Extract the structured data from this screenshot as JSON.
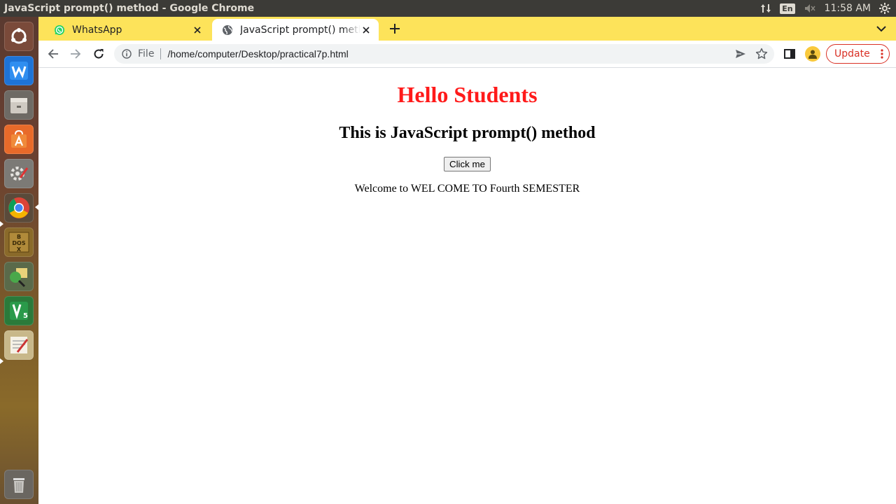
{
  "window": {
    "title": "JavaScript prompt() method - Google Chrome"
  },
  "system": {
    "language": "En",
    "time": "11:58 AM"
  },
  "launcher": {
    "items": [
      {
        "name": "dash-home-icon"
      },
      {
        "name": "wps-writer-icon"
      },
      {
        "name": "files-icon"
      },
      {
        "name": "software-center-icon"
      },
      {
        "name": "system-settings-icon"
      },
      {
        "name": "chrome-icon"
      },
      {
        "name": "dosbox-icon"
      },
      {
        "name": "network-tool-icon"
      },
      {
        "name": "v5-app-icon"
      },
      {
        "name": "text-editor-icon"
      },
      {
        "name": "trash-icon"
      }
    ]
  },
  "tabs": [
    {
      "label": "WhatsApp",
      "icon": "whatsapp-icon"
    },
    {
      "label": "JavaScript prompt() meth",
      "icon": "globe-icon"
    }
  ],
  "omnibox": {
    "scheme_label": "File",
    "url": "/home/computer/Desktop/practical7p.html"
  },
  "toolbar": {
    "update_label": "Update"
  },
  "page": {
    "heading": "Hello Students",
    "subheading": "This is JavaScript prompt() method",
    "button_label": "Click me",
    "message": "Welcome to WEL COME TO Fourth SEMESTER"
  },
  "colors": {
    "heading": "#ff1a1a",
    "tabstrip": "#fde35a",
    "update_accent": "#d93025",
    "topbar": "#3c3b37"
  }
}
